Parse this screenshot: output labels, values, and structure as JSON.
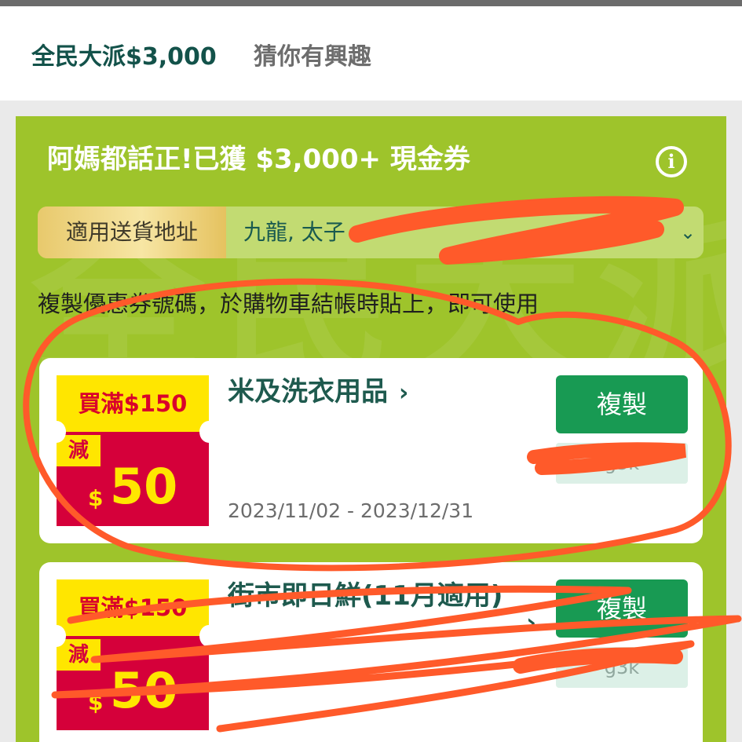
{
  "tabs": [
    {
      "label": "全民大派$3,000"
    },
    {
      "label": "猜你有興趣"
    }
  ],
  "panel": {
    "title": "阿媽都話正!已獲 $3,000+ 現金券",
    "watermark": "全民大派",
    "address_label": "適用送貨地址",
    "address_value": "九龍, 太子",
    "instruction": "複製優惠券號碼，於購物車結帳時貼上，即可使用"
  },
  "coupons": [
    {
      "threshold": "買滿$150",
      "discount_label": "減",
      "currency": "$",
      "amount": "50",
      "title": "米及洗衣用品",
      "date_range": "2023/11/02 - 2023/12/31",
      "copy_label": "複製",
      "code": "g3k"
    },
    {
      "threshold": "買滿$150",
      "discount_label": "減",
      "currency": "$",
      "amount": "50",
      "title": "街市即日鮮(11月適用)",
      "copy_label": "複製",
      "code": "g3k"
    }
  ],
  "icons": {
    "info": "info-icon",
    "chevron": "chevron-down-icon"
  },
  "colors": {
    "accent_green": "#189a53",
    "panel_green": "#9ec42b",
    "badge_red": "#d5003a",
    "badge_yellow": "#ffe600",
    "annotation_orange": "#ff5a2a"
  }
}
